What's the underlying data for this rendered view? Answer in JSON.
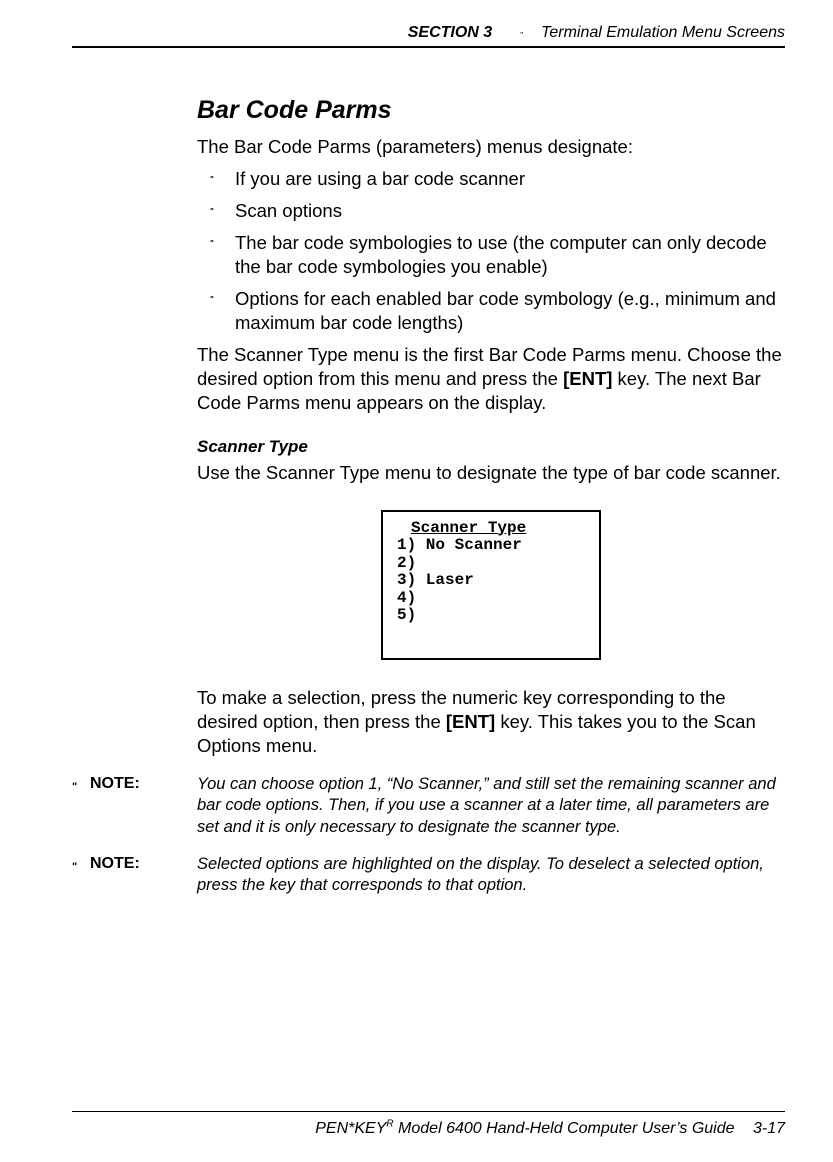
{
  "header": {
    "section": "SECTION 3",
    "title": "Terminal Emulation Menu Screens"
  },
  "heading": "Bar Code Parms",
  "intro": "The Bar Code Parms (parameters) menus designate:",
  "bullets": [
    "If you are using a bar code scanner",
    "Scan options",
    "The bar code symbologies to use (the computer can only decode the bar code symbologies you enable)",
    "Options for each enabled bar code symbology (e.g., minimum and maximum bar code lengths)"
  ],
  "para_after_bullets": {
    "pre": "The Scanner Type menu is the first Bar Code Parms menu. Choose the desired option from this menu and press the ",
    "key": "[ENT]",
    "post": " key.  The next Bar Code Parms menu appears on the display."
  },
  "subhead": "Scanner Type",
  "sub_text": "Use the Scanner Type menu to designate the type of bar code scanner.",
  "screen": {
    "title": "Scanner Type",
    "line1": "1) No Scanner",
    "line2": "2)",
    "line3": "3) Laser",
    "line4": "4)",
    "line5": "5)"
  },
  "para_after_screen": {
    "pre": "To make a selection, press the numeric key corresponding to the desired option, then press the ",
    "key": "[ENT]",
    "post": " key.  This takes you to the Scan Options menu."
  },
  "notes": [
    {
      "label": "NOTE:",
      "text": "You can choose option 1, “No Scanner,” and still set the remaining scanner and bar code options.  Then, if you use a scanner at a later time, all parameters are set and it is only necessary to designate the scanner type."
    },
    {
      "label": "NOTE:",
      "text": "Selected options are highlighted on the display.  To deselect a selected option, press the key that corresponds to that option."
    }
  ],
  "footer": {
    "book_pre": "PEN*KEY",
    "book_sup": "R",
    "book_post": " Model 6400 Hand-Held Computer User’s Guide",
    "pagenum": "3-17"
  }
}
